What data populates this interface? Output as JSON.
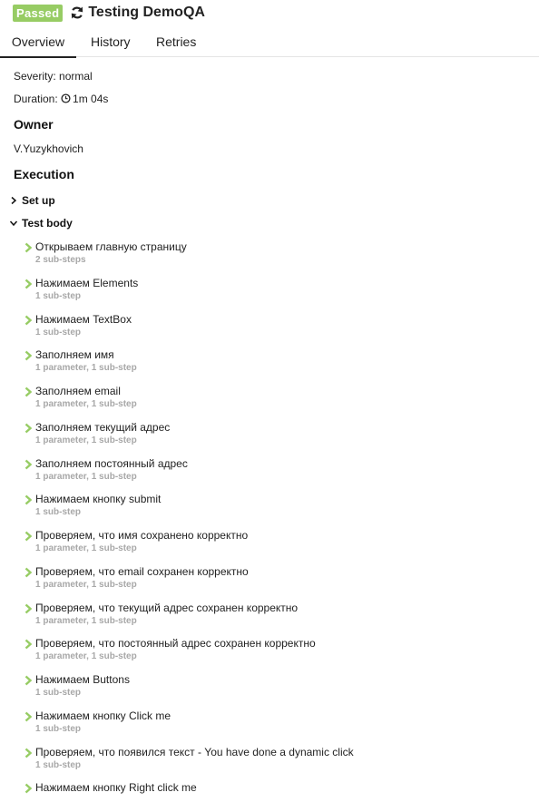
{
  "header": {
    "status": "Passed",
    "title": "Testing DemoQA",
    "retry_icon": "refresh-icon",
    "status_color": "#97cc64"
  },
  "tabs": [
    {
      "label": "Overview",
      "active": true
    },
    {
      "label": "History",
      "active": false
    },
    {
      "label": "Retries",
      "active": false
    }
  ],
  "overview": {
    "severity": "Severity: normal",
    "duration_label": "Duration:",
    "duration_icon": "clock-icon",
    "duration_value": "1m 04s",
    "owner_heading": "Owner",
    "owner_name": "V.Yuzykhovich",
    "execution_heading": "Execution"
  },
  "execution": {
    "setup_label": "Set up",
    "body_label": "Test body",
    "step_icon_color": "#97cc64",
    "steps": [
      {
        "name": "Открываем главную страницу",
        "meta": "2 sub-steps"
      },
      {
        "name": "Нажимаем Elements",
        "meta": "1 sub-step"
      },
      {
        "name": "Нажимаем TextBox",
        "meta": "1 sub-step"
      },
      {
        "name": "Заполняем имя",
        "meta": "1 parameter, 1 sub-step"
      },
      {
        "name": "Заполняем email",
        "meta": "1 parameter, 1 sub-step"
      },
      {
        "name": "Заполняем текущий адрес",
        "meta": "1 parameter, 1 sub-step"
      },
      {
        "name": "Заполняем постоянный адрес",
        "meta": "1 parameter, 1 sub-step"
      },
      {
        "name": "Нажимаем кнопку submit",
        "meta": "1 sub-step"
      },
      {
        "name": "Проверяем, что имя сохранено корректно",
        "meta": "1 parameter, 1 sub-step"
      },
      {
        "name": "Проверяем, что email сохранен корректно",
        "meta": "1 parameter, 1 sub-step"
      },
      {
        "name": "Проверяем, что текущий адрес сохранен корректно",
        "meta": "1 parameter, 1 sub-step"
      },
      {
        "name": "Проверяем, что постоянный адрес сохранен корректно",
        "meta": "1 parameter, 1 sub-step"
      },
      {
        "name": "Нажимаем Buttons",
        "meta": "1 sub-step"
      },
      {
        "name": "Нажимаем кнопку Click me",
        "meta": "1 sub-step"
      },
      {
        "name": "Проверяем, что появился текст - You have done a dynamic click",
        "meta": "1 sub-step"
      },
      {
        "name": "Нажимаем кнопку Right click me",
        "meta": ""
      }
    ]
  }
}
